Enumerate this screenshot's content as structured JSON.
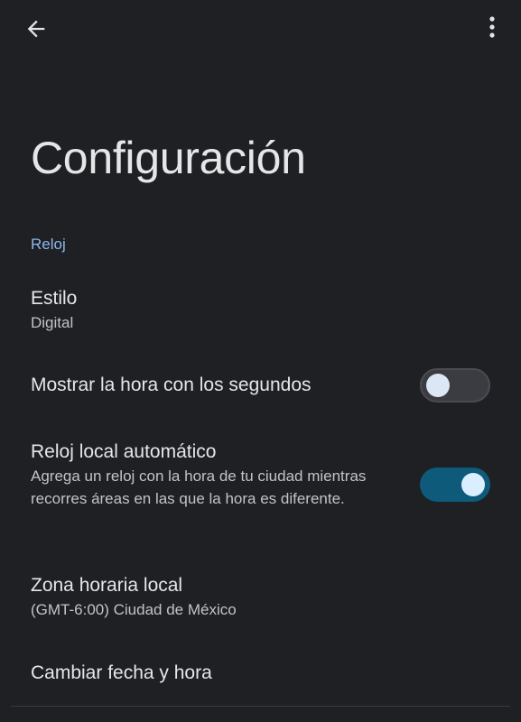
{
  "topbar": {
    "back_icon": "arrow-back-icon",
    "more_icon": "more-vert-icon"
  },
  "page": {
    "title": "Configuración"
  },
  "section": {
    "header": "Reloj"
  },
  "settings": {
    "style": {
      "title": "Estilo",
      "value": "Digital"
    },
    "show_seconds": {
      "title": "Mostrar la hora con los segundos",
      "enabled": false
    },
    "auto_home_clock": {
      "title": "Reloj local automático",
      "description": "Agrega un reloj con la hora de tu ciudad mientras recorres áreas en las que la hora es diferente.",
      "enabled": true
    },
    "home_timezone": {
      "title": "Zona horaria local",
      "value": "(GMT-6:00) Ciudad de México"
    },
    "change_date_time": {
      "title": "Cambiar fecha y hora"
    }
  },
  "colors": {
    "background": "#1f2023",
    "accent": "#8ab8ee",
    "toggle_on_track": "#0e5a7a",
    "toggle_off_track": "#3a3c41"
  }
}
